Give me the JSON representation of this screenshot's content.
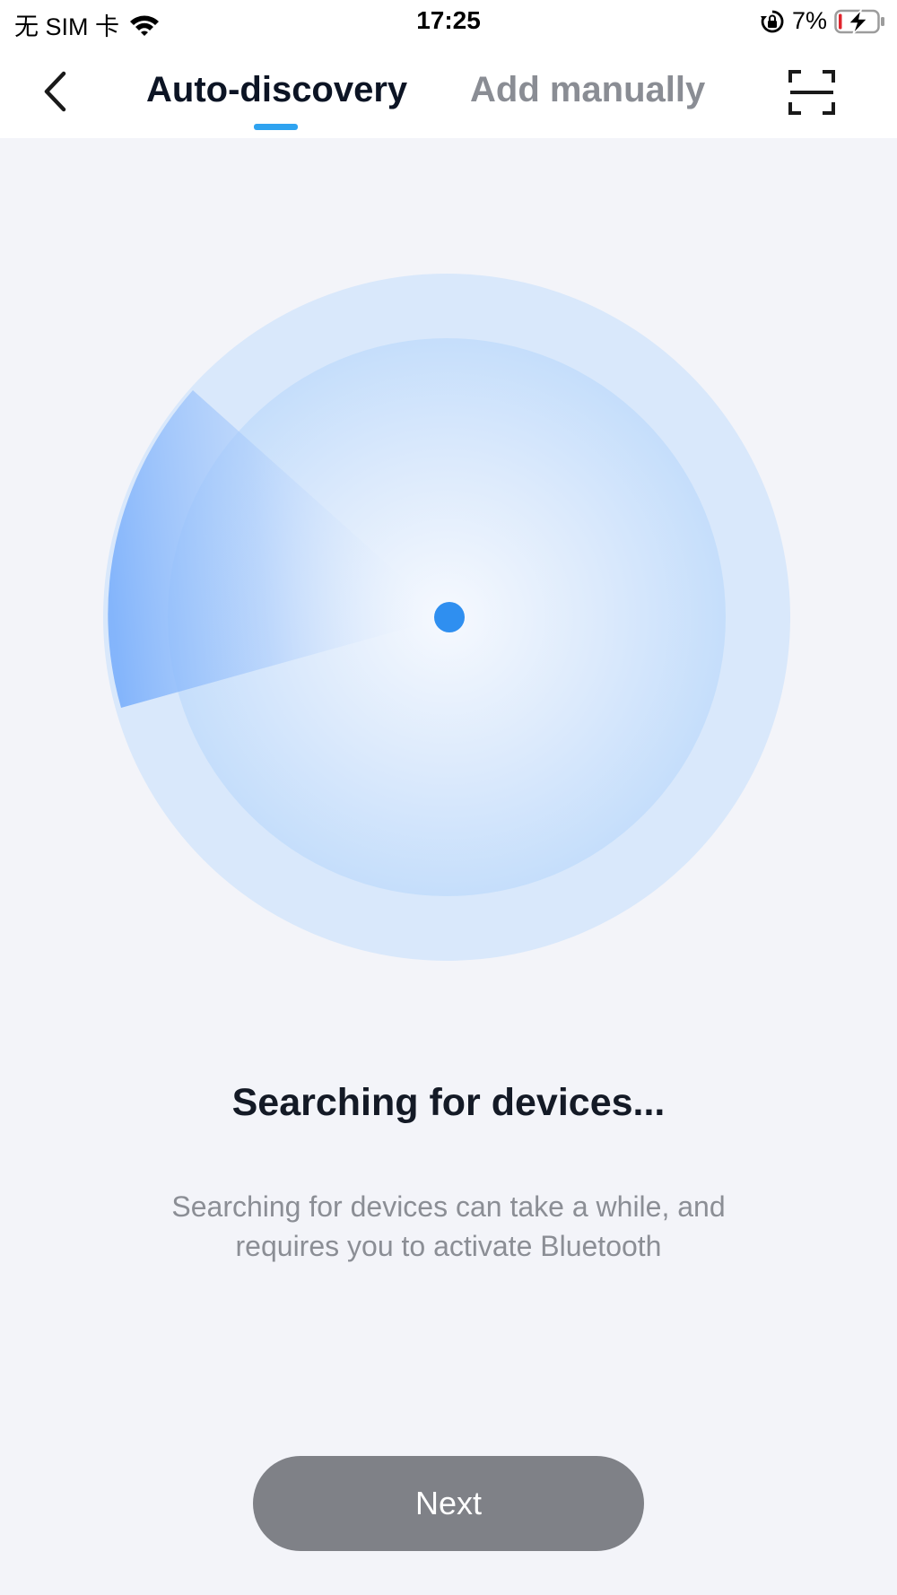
{
  "status_bar": {
    "carrier": "无 SIM 卡",
    "time": "17:25",
    "battery_percent": "7%",
    "battery_level": 0.07
  },
  "nav": {
    "tabs": [
      {
        "label": "Auto-discovery",
        "active": true
      },
      {
        "label": "Add manually",
        "active": false
      }
    ],
    "icons": {
      "back": "chevron-left-icon",
      "scan": "scan-frame-icon"
    }
  },
  "main": {
    "title": "Searching for devices...",
    "description": "Searching for devices can take a while, and requires you to activate Bluetooth",
    "next_label": "Next"
  },
  "colors": {
    "accent": "#2fa3f0",
    "radar_dot": "#2f8ff0",
    "radar_outer": "#d9e8fb",
    "button_disabled": "#7f8187",
    "background": "#f3f4f9"
  }
}
